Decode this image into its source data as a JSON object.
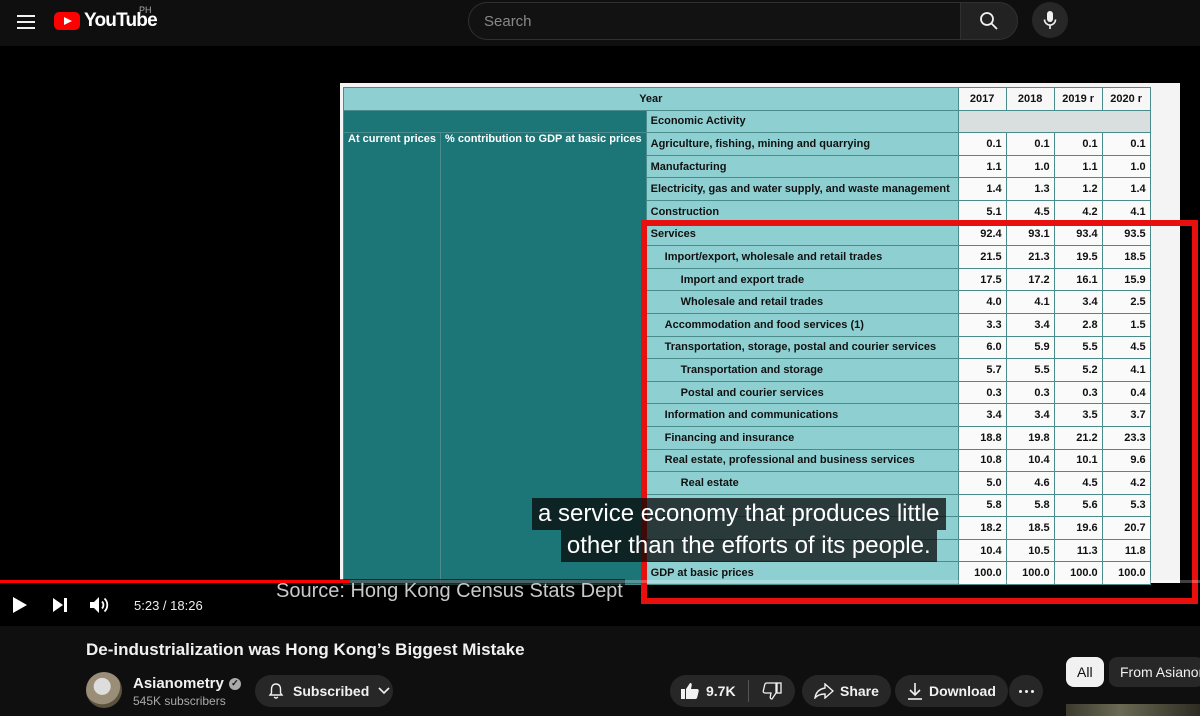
{
  "header": {
    "logo_text": "YouTube",
    "country": "PH",
    "search_placeholder": "Search"
  },
  "table": {
    "year_label": "Year",
    "years": [
      "2017",
      "2018",
      "2019 r",
      "2020 r"
    ],
    "economic_activity_label": "Economic Activity",
    "left_label_1": "At current prices",
    "left_label_2": "% contribution to GDP at basic prices",
    "rows": [
      {
        "label": "Agriculture, fishing, mining and quarrying",
        "indent": 0,
        "values": [
          "0.1",
          "0.1",
          "0.1",
          "0.1"
        ]
      },
      {
        "label": "Manufacturing",
        "indent": 0,
        "values": [
          "1.1",
          "1.0",
          "1.1",
          "1.0"
        ]
      },
      {
        "label": "Electricity, gas and water supply, and waste management",
        "indent": 0,
        "values": [
          "1.4",
          "1.3",
          "1.2",
          "1.4"
        ]
      },
      {
        "label": "Construction",
        "indent": 0,
        "values": [
          "5.1",
          "4.5",
          "4.2",
          "4.1"
        ]
      },
      {
        "label": "Services",
        "indent": 0,
        "values": [
          "92.4",
          "93.1",
          "93.4",
          "93.5"
        ]
      },
      {
        "label": "Import/export, wholesale and retail trades",
        "indent": 1,
        "values": [
          "21.5",
          "21.3",
          "19.5",
          "18.5"
        ]
      },
      {
        "label": "Import and export trade",
        "indent": 2,
        "values": [
          "17.5",
          "17.2",
          "16.1",
          "15.9"
        ]
      },
      {
        "label": "Wholesale and retail trades",
        "indent": 2,
        "values": [
          "4.0",
          "4.1",
          "3.4",
          "2.5"
        ]
      },
      {
        "label": "Accommodation and food services (1)",
        "indent": 1,
        "values": [
          "3.3",
          "3.4",
          "2.8",
          "1.5"
        ]
      },
      {
        "label": "Transportation, storage, postal and courier services",
        "indent": 1,
        "values": [
          "6.0",
          "5.9",
          "5.5",
          "4.5"
        ]
      },
      {
        "label": "Transportation and storage",
        "indent": 2,
        "values": [
          "5.7",
          "5.5",
          "5.2",
          "4.1"
        ]
      },
      {
        "label": "Postal and courier services",
        "indent": 2,
        "values": [
          "0.3",
          "0.3",
          "0.3",
          "0.4"
        ]
      },
      {
        "label": "Information and communications",
        "indent": 1,
        "values": [
          "3.4",
          "3.4",
          "3.5",
          "3.7"
        ]
      },
      {
        "label": "Financing and insurance",
        "indent": 1,
        "values": [
          "18.8",
          "19.8",
          "21.2",
          "23.3"
        ]
      },
      {
        "label": "Real estate, professional and business services",
        "indent": 1,
        "values": [
          "10.8",
          "10.4",
          "10.1",
          "9.6"
        ]
      },
      {
        "label": "Real estate",
        "indent": 2,
        "values": [
          "5.0",
          "4.6",
          "4.5",
          "4.2"
        ]
      },
      {
        "label": "",
        "indent": 2,
        "values": [
          "5.8",
          "5.8",
          "5.6",
          "5.3"
        ]
      },
      {
        "label": "",
        "indent": 1,
        "values": [
          "18.2",
          "18.5",
          "19.6",
          "20.7"
        ]
      },
      {
        "label": "",
        "indent": 1,
        "values": [
          "10.4",
          "10.5",
          "11.3",
          "11.8"
        ]
      },
      {
        "label": "GDP at basic prices",
        "indent": 0,
        "values": [
          "100.0",
          "100.0",
          "100.0",
          "100.0"
        ]
      }
    ]
  },
  "overlay": {
    "source": "Source: Hong Kong Census Stats Dept",
    "caption_line1": "a service economy that produces little",
    "caption_line2": "other than the efforts of its people."
  },
  "player": {
    "time": "5:23 / 18:26",
    "progress": 0.292
  },
  "video": {
    "title": "De-industrialization was Hong Kong’s Biggest Mistake",
    "channel": "Asianometry",
    "subscribers": "545K subscribers",
    "subscribed_label": "Subscribed",
    "likes": "9.7K",
    "share_label": "Share",
    "download_label": "Download"
  },
  "chips": {
    "all": "All",
    "from": "From Asianometry"
  },
  "colors": {
    "accent": "#ff0000",
    "highlight_box": "#e8100f",
    "table_teal": "#1c7577",
    "table_header": "#8ed0d2"
  }
}
